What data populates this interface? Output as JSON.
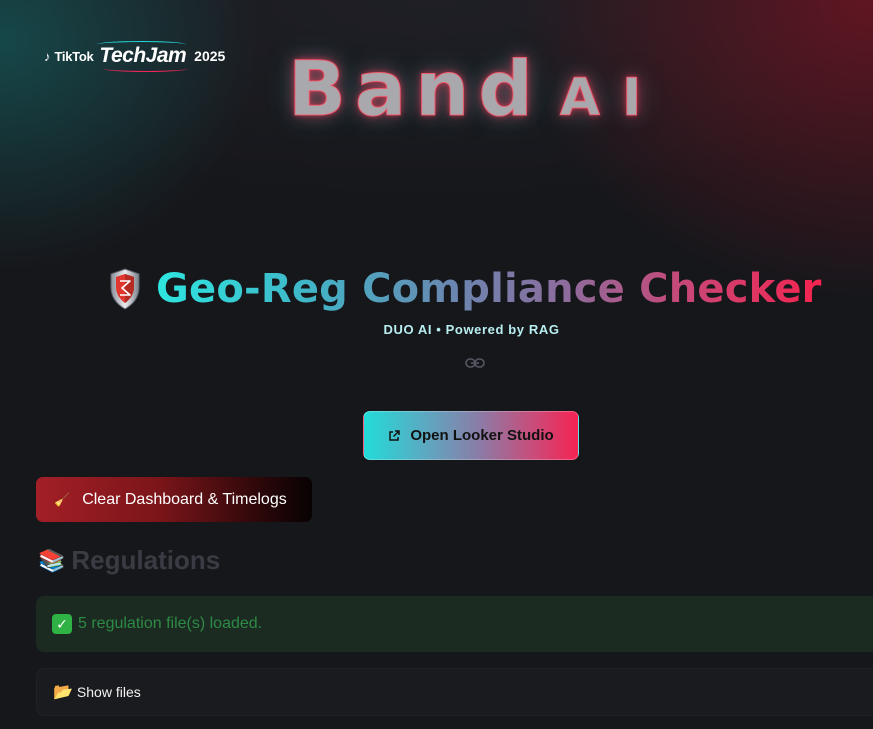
{
  "logo": {
    "tiktok": "TikTok",
    "techjam": "TechJam",
    "year": "2025",
    "note_glyph": "♪"
  },
  "brand": {
    "band": "Band",
    "ai": "AI"
  },
  "header": {
    "title": "Geo-Reg Compliance Checker",
    "subtitle": "DUO AI • Powered by RAG",
    "shield_icon": "shield-icon"
  },
  "actions": {
    "looker_label": "Open Looker Studio",
    "clear_label": "Clear Dashboard & Timelogs",
    "clear_icon": "🧹"
  },
  "regulations": {
    "heading": "Regulations",
    "heading_icon": "📚",
    "status_message": "5 regulation file(s) loaded.",
    "check_glyph": "✓",
    "expander_label": "Show files",
    "expander_icon": "📂"
  },
  "colors": {
    "accent_cyan": "#22dcd8",
    "accent_red": "#f52353",
    "success_bg": "#1c2b21",
    "success_text": "#2d8a46",
    "danger_btn": "#a31f27"
  }
}
